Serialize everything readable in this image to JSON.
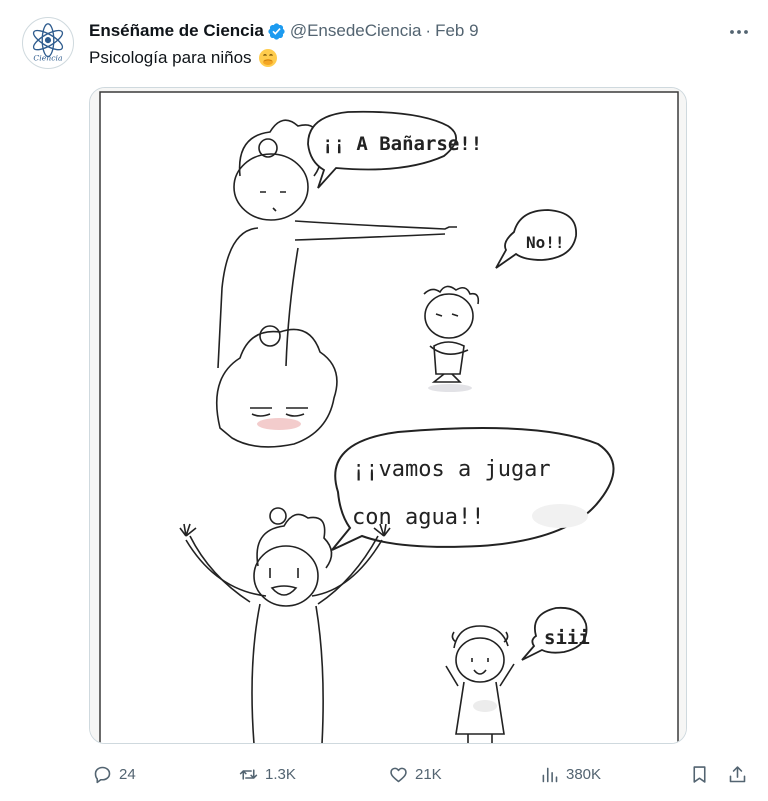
{
  "author": {
    "display_name": "Enséñame de Ciencia",
    "handle": "@EnsedeCiencia",
    "separator": "·",
    "date": "Feb 9",
    "avatar_text": "Ciencia",
    "verified_icon": "verified-badge-icon"
  },
  "tweet": {
    "text": "Psicología para niños",
    "emoji": "face-with-hand-over-mouth-emoji"
  },
  "comic": {
    "bubble_1": "¡¡ A Bañarse!!",
    "bubble_2": "No!!",
    "bubble_3_line1": "¡¡vamos a jugar",
    "bubble_3_line2": "con agua!!",
    "bubble_4": "siii"
  },
  "actions": {
    "replies": "24",
    "retweets": "1.3K",
    "likes": "21K",
    "views": "380K"
  },
  "colors": {
    "text_primary": "#0f1419",
    "text_secondary": "#536471",
    "verified_blue": "#1d9bf0",
    "border": "#cfd9de"
  }
}
